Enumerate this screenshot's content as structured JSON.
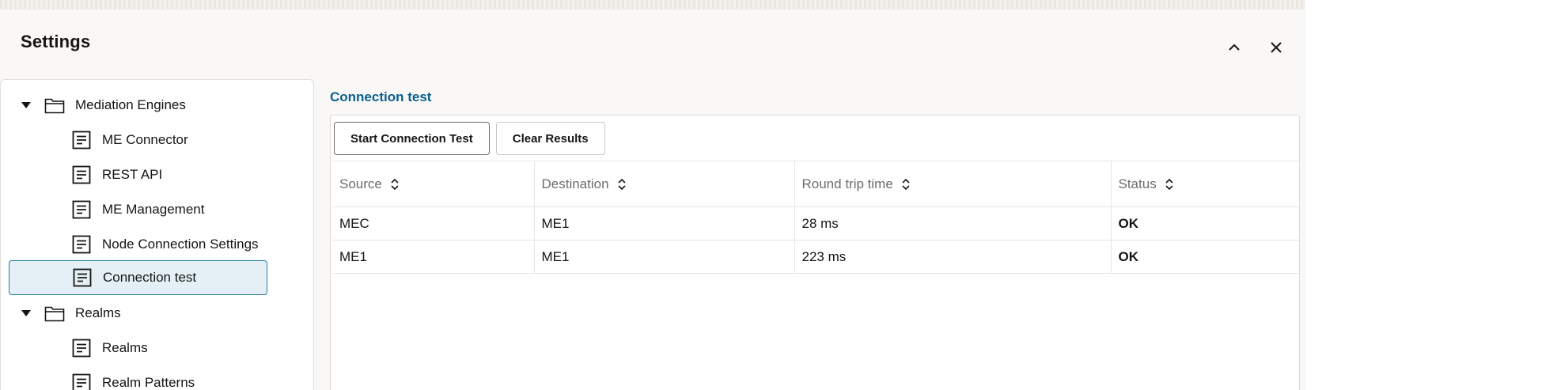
{
  "header": {
    "title": "Settings",
    "collapse_icon": "chevron-up-icon",
    "close_icon": "close-icon"
  },
  "tree": {
    "items": [
      {
        "label": "Mediation Engines",
        "type": "folder",
        "expanded": true,
        "icon": "folder-icon"
      },
      {
        "label": "ME Connector",
        "type": "leaf",
        "icon": "document-icon"
      },
      {
        "label": "REST API",
        "type": "leaf",
        "icon": "document-icon"
      },
      {
        "label": "ME Management",
        "type": "leaf",
        "icon": "document-icon"
      },
      {
        "label": "Node Connection Settings",
        "type": "leaf",
        "icon": "document-icon"
      },
      {
        "label": "Connection test",
        "type": "leaf",
        "icon": "document-icon",
        "selected": true
      },
      {
        "label": "Realms",
        "type": "folder",
        "expanded": true,
        "icon": "folder-icon"
      },
      {
        "label": "Realms",
        "type": "leaf",
        "icon": "document-icon"
      },
      {
        "label": "Realm Patterns",
        "type": "leaf",
        "icon": "document-icon"
      }
    ]
  },
  "main": {
    "section_title": "Connection test",
    "toolbar": {
      "start_label": "Start Connection Test",
      "clear_label": "Clear Results"
    },
    "table": {
      "columns": [
        "Source",
        "Destination",
        "Round trip time",
        "Status"
      ],
      "rows": [
        {
          "source": "MEC",
          "destination": "ME1",
          "rtt": "28 ms",
          "status": "OK"
        },
        {
          "source": "ME1",
          "destination": "ME1",
          "rtt": "223 ms",
          "status": "OK"
        }
      ]
    }
  },
  "colors": {
    "accent": "#0a6090",
    "selected_bg": "#e4f0f5",
    "selected_border": "#227e9e",
    "status_ok": "#3c7a2b"
  }
}
